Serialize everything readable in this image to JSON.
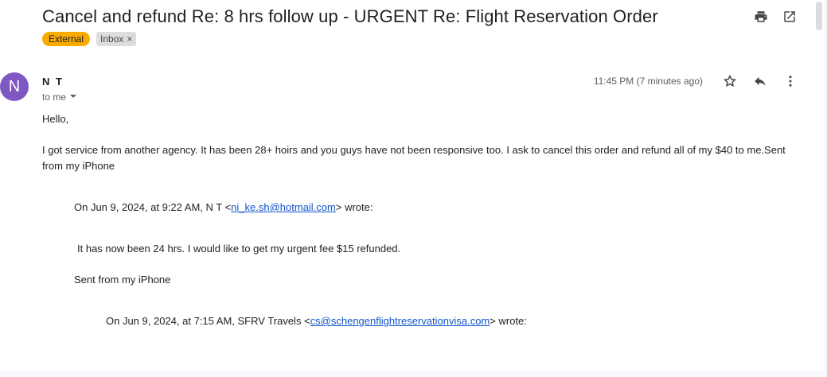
{
  "email": {
    "subject": "Cancel and refund Re: 8 hrs follow up - URGENT Re: Flight Reservation Order",
    "labels": {
      "external": "External",
      "inbox": "Inbox",
      "inbox_remove": "×"
    },
    "sender": {
      "avatar_letter": "N",
      "name": "N T",
      "to": "to me"
    },
    "timestamp": "11:45 PM (7 minutes ago)",
    "body": {
      "greeting": "Hello,",
      "line1": "I got service from another agency. It has been 28+ hoirs and you guys have not been responsive too. I ask to cancel this order and refund all of my $40 to me.Sent",
      "line2": "from my iPhone",
      "quote1_prefix": "On Jun 9, 2024, at 9:22 AM, N T <",
      "quote1_email": "ni_ke.sh@hotmail.com",
      "quote1_suffix": "> wrote:",
      "quote1_text": "It has now been 24 hrs. I would like to get my urgent fee $15 refunded.",
      "quote1_sig": "Sent from my iPhone",
      "quote2_prefix": "On Jun 9, 2024, at 7:15 AM, SFRV Travels <",
      "quote2_email": "cs@schengenflightreservationvisa.com",
      "quote2_suffix": "> wrote:"
    }
  },
  "colors": {
    "external_tag": "#f9ab00",
    "avatar": "#7e57c2",
    "link": "#1155cc"
  },
  "icons": {
    "print": "print-icon",
    "open_new_window": "open-in-new-window-icon",
    "star": "star-icon",
    "reply": "reply-icon",
    "more": "more-vert-icon",
    "dropdown": "caret-down-icon"
  }
}
